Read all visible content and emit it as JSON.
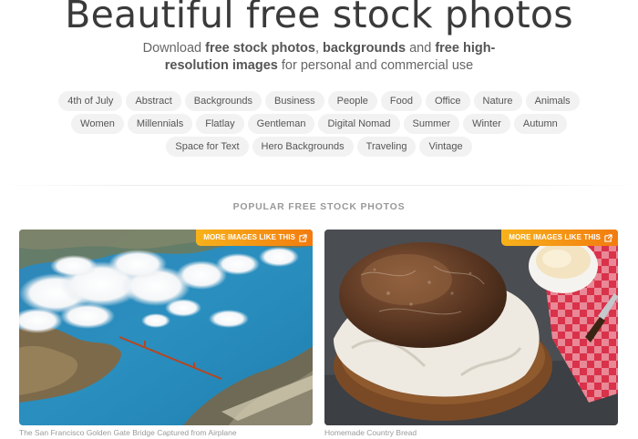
{
  "hero": {
    "title": "Beautiful free stock photos",
    "subtitle_parts": {
      "p1": "Download ",
      "b1": "free stock photos",
      "p2": ", ",
      "b2": "backgrounds",
      "p3": " and ",
      "b3": "free high-resolution images",
      "p4": " for personal and commercial use"
    }
  },
  "tags": [
    "4th of July",
    "Abstract",
    "Backgrounds",
    "Business",
    "People",
    "Food",
    "Office",
    "Nature",
    "Animals",
    "Women",
    "Millennials",
    "Flatlay",
    "Gentleman",
    "Digital Nomad",
    "Summer",
    "Winter",
    "Autumn",
    "Space for Text",
    "Hero Backgrounds",
    "Traveling",
    "Vintage"
  ],
  "section": {
    "title": "POPULAR FREE STOCK PHOTOS"
  },
  "photos": [
    {
      "badge": "MORE IMAGES LIKE THIS",
      "caption": "The San Francisco Golden Gate Bridge Captured from Airplane"
    },
    {
      "badge": "MORE IMAGES LIKE THIS",
      "caption": "Homemade Country Bread"
    }
  ],
  "colors": {
    "badge_start": "#f7b21b",
    "badge_end": "#f37b0f",
    "tag_bg": "#f2f2f2"
  }
}
